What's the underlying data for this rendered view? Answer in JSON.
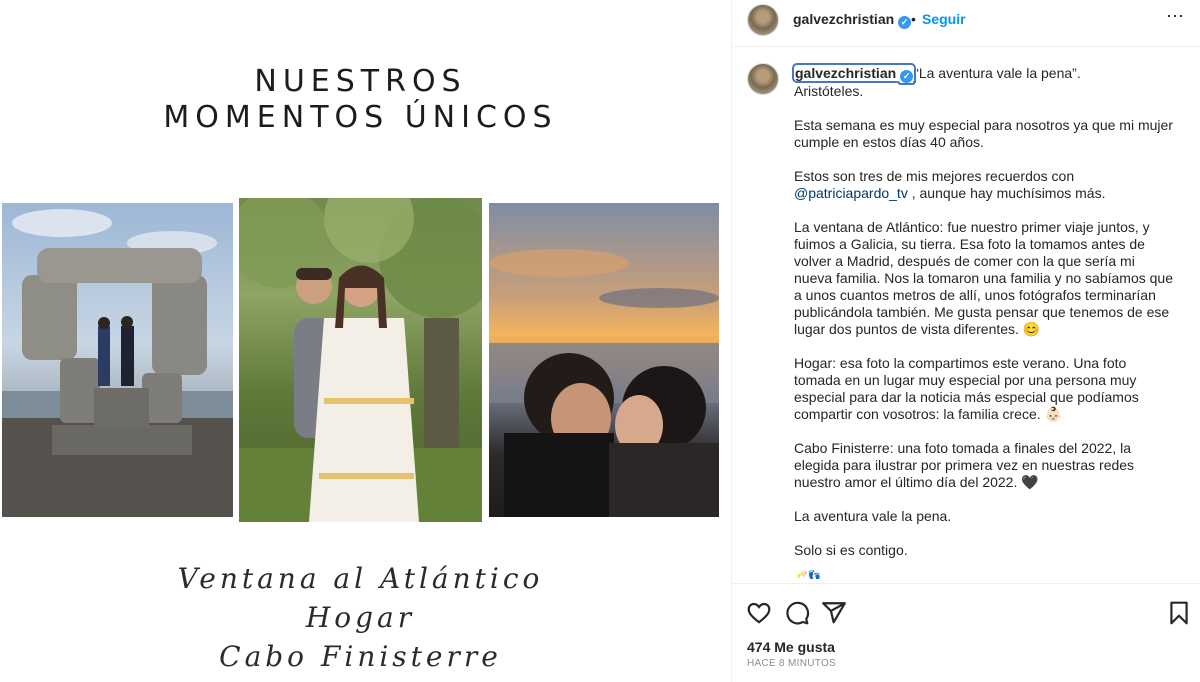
{
  "media": {
    "title_line1": "NUESTROS",
    "title_line2": "MOMENTOS ÚNICOS",
    "caption_line1": "Ventana al Atlántico",
    "caption_line2": "Hogar",
    "caption_line3": "Cabo Finisterre"
  },
  "header": {
    "username": "galvezchristian",
    "verified_icon": "verified-badge-icon",
    "separator": "•",
    "follow_label": "Seguir",
    "more_label": "⋯"
  },
  "post": {
    "username": "galvezchristian",
    "quote": "“La aventura vale la pena”.",
    "author": "Aristóteles.",
    "p1": "Esta semana es muy especial para nosotros ya que mi mujer cumple en estos días 40 años.",
    "p2_before": "Estos son tres de mis mejores recuerdos con ",
    "p2_mention": "@patriciapardo_tv",
    "p2_after": " , aunque hay muchísimos más.",
    "p3": "La ventana de Atlántico: fue nuestro primer viaje juntos, y fuimos a Galicia, su tierra. Esa foto la tomamos antes de volver a Madrid, después de comer con la que sería mi nueva familia. Nos la tomaron una familia y no sabíamos que a unos cuantos metros de allí, unos fotógrafos terminarían publicándola también. Me gusta pensar que tenemos de ese lugar dos puntos de vista diferentes. 😊",
    "p4": "Hogar: esa foto la compartimos este verano. Una foto tomada en un lugar muy especial por una persona muy especial para dar la noticia más especial que podíamos compartir con vosotros: la familia crece. 👶🏻",
    "p5": "Cabo Finisterre: una foto tomada a finales del 2022, la elegida para ilustrar por primera vez en nuestras redes nuestro amor el último día del 2022. 🖤",
    "p6": "La aventura vale la pena.",
    "p7": "Solo si es contigo.",
    "p8": "🥂👣"
  },
  "actions": {
    "icons": [
      "heart-icon",
      "comment-icon",
      "share-icon",
      "bookmark-icon"
    ],
    "likes": "474 Me gusta",
    "time": "HACE 8 MINUTOS"
  },
  "colors": {
    "link": "#0095f6",
    "mention": "#00376b",
    "verified": "#3897f0",
    "text": "#262626",
    "muted": "#8e8e8e"
  }
}
